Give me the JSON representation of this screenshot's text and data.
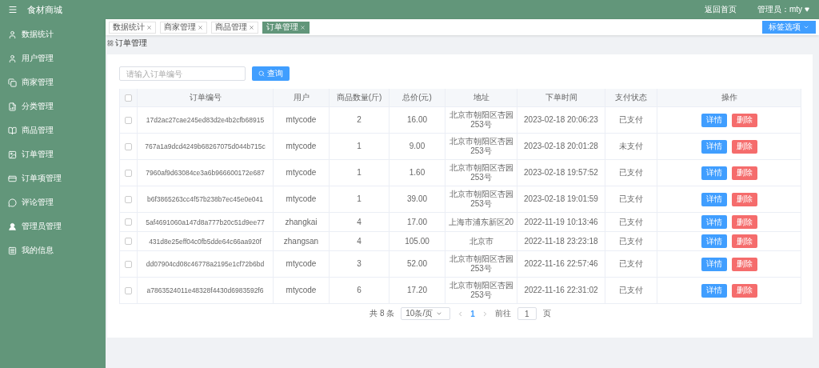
{
  "header": {
    "title": "食材商城",
    "home_link": "返回首页",
    "user": "管理员：mty"
  },
  "sidebar": {
    "items": [
      {
        "label": "数据统计",
        "kind": "user"
      },
      {
        "label": "用户管理",
        "kind": "user"
      },
      {
        "label": "商家管理",
        "kind": "copy"
      },
      {
        "label": "分类管理",
        "kind": "chart"
      },
      {
        "label": "商品管理",
        "kind": "book"
      },
      {
        "label": "订单管理",
        "kind": "image"
      },
      {
        "label": "订单项管理",
        "kind": "card"
      },
      {
        "label": "评论管理",
        "kind": "comment"
      },
      {
        "label": "管理员管理",
        "kind": "person"
      },
      {
        "label": "我的信息",
        "kind": "square"
      }
    ]
  },
  "tabs": [
    {
      "label": "数据统计",
      "selected": false
    },
    {
      "label": "商家管理",
      "selected": false
    },
    {
      "label": "商品管理",
      "selected": false
    },
    {
      "label": "订单管理",
      "selected": true
    }
  ],
  "tab_options": "标签选项",
  "breadcrumb": "订单管理",
  "search": {
    "placeholder": "请输入订单编号",
    "button": "查询"
  },
  "table": {
    "all_checked": false,
    "columns": [
      "订单编号",
      "用户",
      "商品数量(斤)",
      "总价(元)",
      "地址",
      "下单时间",
      "支付状态",
      "操作"
    ],
    "rows": [
      {
        "checked": false,
        "cells": [
          "17d2ac27cae245ed83d2e4b2cfb68915",
          "mtycode",
          "2",
          "16.00",
          "北京市朝阳区杏园253号",
          "2023-02-18 20:06:23",
          "已支付"
        ],
        "actions": [
          {
            "label": "详情",
            "kind": "primary"
          },
          {
            "label": "删除",
            "kind": "danger"
          }
        ]
      },
      {
        "checked": false,
        "cells": [
          "767a1a9dcd4249b68267075d044b715c",
          "mtycode",
          "1",
          "9.00",
          "北京市朝阳区杏园253号",
          "2023-02-18 20:01:28",
          "未支付"
        ],
        "actions": [
          {
            "label": "详情",
            "kind": "primary"
          },
          {
            "label": "删除",
            "kind": "danger"
          }
        ]
      },
      {
        "checked": false,
        "cells": [
          "7960af9d63084ce3a6b966600172e687",
          "mtycode",
          "1",
          "1.60",
          "北京市朝阳区杏园253号",
          "2023-02-18 19:57:52",
          "已支付"
        ],
        "actions": [
          {
            "label": "详情",
            "kind": "primary"
          },
          {
            "label": "删除",
            "kind": "danger"
          }
        ]
      },
      {
        "checked": false,
        "cells": [
          "b6f3865263cc4f57b238b7ec45e0e041",
          "mtycode",
          "1",
          "39.00",
          "北京市朝阳区杏园253号",
          "2023-02-18 19:01:59",
          "已支付"
        ],
        "actions": [
          {
            "label": "详情",
            "kind": "primary"
          },
          {
            "label": "删除",
            "kind": "danger"
          }
        ]
      },
      {
        "checked": false,
        "cells": [
          "5af4691060a147d8a777b20c51d9ee77",
          "zhangkai",
          "4",
          "17.00",
          "上海市浦东新区20",
          "2022-11-19 10:13:46",
          "已支付"
        ],
        "actions": [
          {
            "label": "详情",
            "kind": "primary"
          },
          {
            "label": "删除",
            "kind": "danger"
          }
        ]
      },
      {
        "checked": false,
        "cells": [
          "431d8e25eff04c0fb5dde64c66aa920f",
          "zhangsan",
          "4",
          "105.00",
          "北京市",
          "2022-11-18 23:23:18",
          "已支付"
        ],
        "actions": [
          {
            "label": "详情",
            "kind": "primary"
          },
          {
            "label": "删除",
            "kind": "danger"
          }
        ]
      },
      {
        "checked": false,
        "cells": [
          "dd07904cd08c46778a2195e1cf72b6bd",
          "mtycode",
          "3",
          "52.00",
          "北京市朝阳区杏园253号",
          "2022-11-16 22:57:46",
          "已支付"
        ],
        "actions": [
          {
            "label": "详情",
            "kind": "primary"
          },
          {
            "label": "删除",
            "kind": "danger"
          }
        ]
      },
      {
        "checked": false,
        "cells": [
          "a7863524011e48328f4430d6983592f6",
          "mtycode",
          "6",
          "17.20",
          "北京市朝阳区杏园253号",
          "2022-11-16 22:31:02",
          "已支付"
        ],
        "actions": [
          {
            "label": "详情",
            "kind": "primary"
          },
          {
            "label": "删除",
            "kind": "danger"
          }
        ]
      }
    ]
  },
  "pagination": {
    "total": "共 8 条",
    "page_size": "10条/页",
    "pages": [
      {
        "label": "1",
        "selected": true
      }
    ],
    "goto_label": "前往",
    "goto_value": "1",
    "goto_suffix": "页"
  }
}
